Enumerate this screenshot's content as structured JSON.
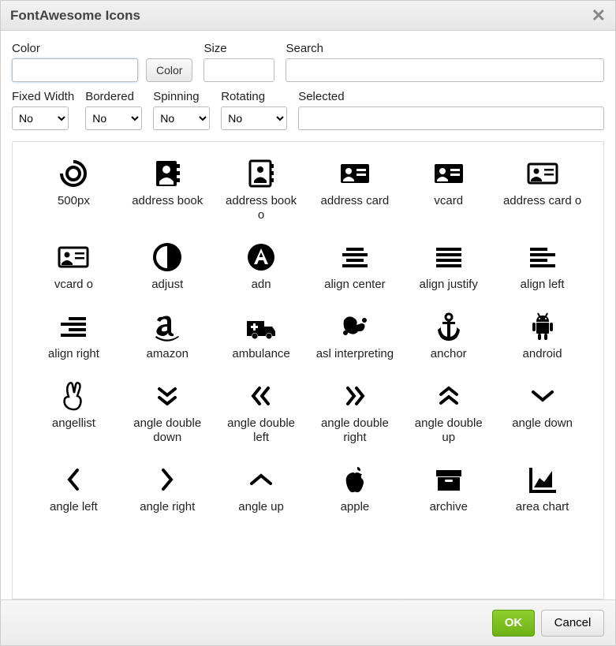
{
  "dialog": {
    "title": "FontAwesome Icons"
  },
  "fields": {
    "color_label": "Color",
    "color_value": "",
    "color_button": "Color",
    "size_label": "Size",
    "size_value": "",
    "search_label": "Search",
    "search_value": "",
    "fixed_width_label": "Fixed Width",
    "fixed_width_value": "No",
    "bordered_label": "Bordered",
    "bordered_value": "No",
    "spinning_label": "Spinning",
    "spinning_value": "No",
    "rotating_label": "Rotating",
    "rotating_value": "No",
    "selected_label": "Selected",
    "selected_value": ""
  },
  "icons": [
    {
      "name": "500px",
      "label": "500px"
    },
    {
      "name": "address-book",
      "label": "address book"
    },
    {
      "name": "address-book-o",
      "label": "address book o"
    },
    {
      "name": "address-card",
      "label": "address card"
    },
    {
      "name": "vcard",
      "label": "vcard"
    },
    {
      "name": "address-card-o",
      "label": "address card o"
    },
    {
      "name": "vcard-o",
      "label": "vcard o"
    },
    {
      "name": "adjust",
      "label": "adjust"
    },
    {
      "name": "adn",
      "label": "adn"
    },
    {
      "name": "align-center",
      "label": "align center"
    },
    {
      "name": "align-justify",
      "label": "align justify"
    },
    {
      "name": "align-left",
      "label": "align left"
    },
    {
      "name": "align-right",
      "label": "align right"
    },
    {
      "name": "amazon",
      "label": "amazon"
    },
    {
      "name": "ambulance",
      "label": "ambulance"
    },
    {
      "name": "asl-interpreting",
      "label": "asl interpreting"
    },
    {
      "name": "anchor",
      "label": "anchor"
    },
    {
      "name": "android",
      "label": "android"
    },
    {
      "name": "angellist",
      "label": "angellist"
    },
    {
      "name": "angle-double-down",
      "label": "angle double down"
    },
    {
      "name": "angle-double-left",
      "label": "angle double left"
    },
    {
      "name": "angle-double-right",
      "label": "angle double right"
    },
    {
      "name": "angle-double-up",
      "label": "angle double up"
    },
    {
      "name": "angle-down",
      "label": "angle down"
    },
    {
      "name": "angle-left",
      "label": "angle left"
    },
    {
      "name": "angle-right",
      "label": "angle right"
    },
    {
      "name": "angle-up",
      "label": "angle up"
    },
    {
      "name": "apple",
      "label": "apple"
    },
    {
      "name": "archive",
      "label": "archive"
    },
    {
      "name": "area-chart",
      "label": "area chart"
    }
  ],
  "footer": {
    "ok": "OK",
    "cancel": "Cancel"
  }
}
